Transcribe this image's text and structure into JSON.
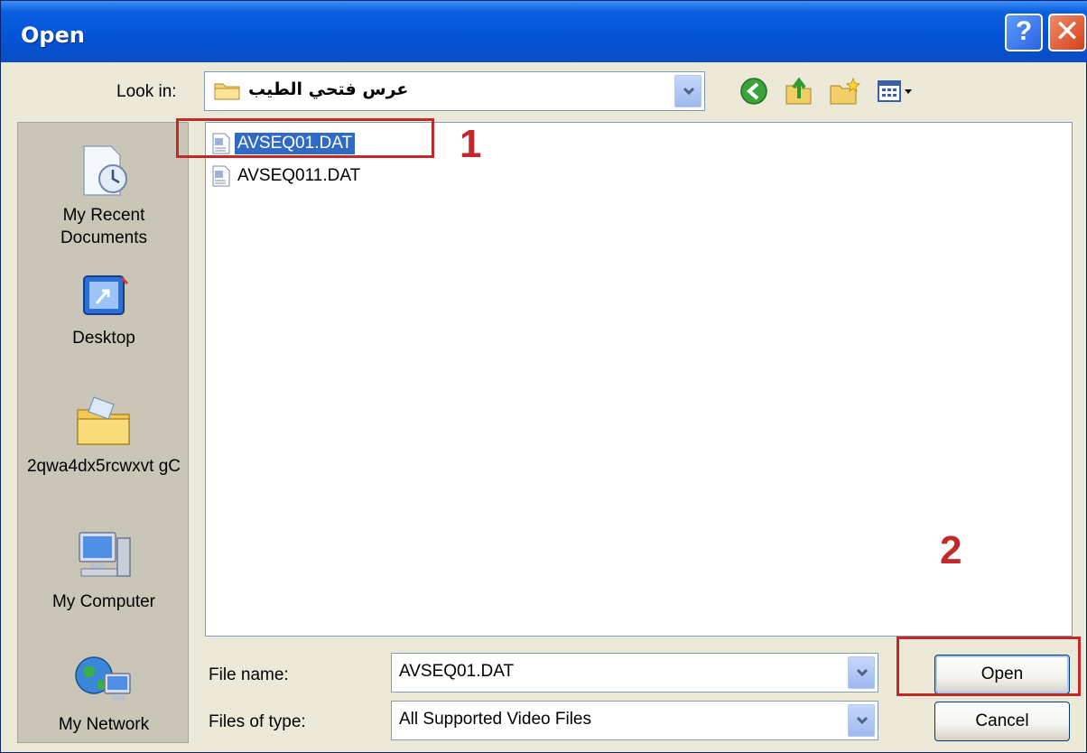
{
  "window": {
    "title": "Open"
  },
  "titlebar_buttons": {
    "help": "?",
    "close": "✕"
  },
  "lookin": {
    "label": "Look in:",
    "value": "عرس فتحي الطيب"
  },
  "toolbar": {
    "icons": [
      "back-icon",
      "up-folder-icon",
      "new-folder-icon",
      "views-menu-icon"
    ]
  },
  "places": [
    {
      "label": "My Recent Documents",
      "icon": "recent-documents-icon"
    },
    {
      "label": "Desktop",
      "icon": "desktop-icon"
    },
    {
      "label": "2qwa4dx5rcwxvt gC",
      "icon": "folder-icon"
    },
    {
      "label": "My Computer",
      "icon": "computer-icon"
    },
    {
      "label": "My Network",
      "icon": "network-icon"
    }
  ],
  "files": [
    {
      "name": "AVSEQ01.DAT",
      "selected": true
    },
    {
      "name": "AVSEQ011.DAT",
      "selected": false
    }
  ],
  "filename": {
    "label": "File name:",
    "value": "AVSEQ01.DAT"
  },
  "filetype": {
    "label": "Files of type:",
    "value": "All Supported Video Files"
  },
  "buttons": {
    "open": "Open",
    "cancel": "Cancel"
  },
  "annotations": {
    "step1": "1",
    "step2": "2"
  },
  "colors": {
    "selection": "#316ac5",
    "annotation": "#c22a2a",
    "titlebar": "#0453d6"
  }
}
